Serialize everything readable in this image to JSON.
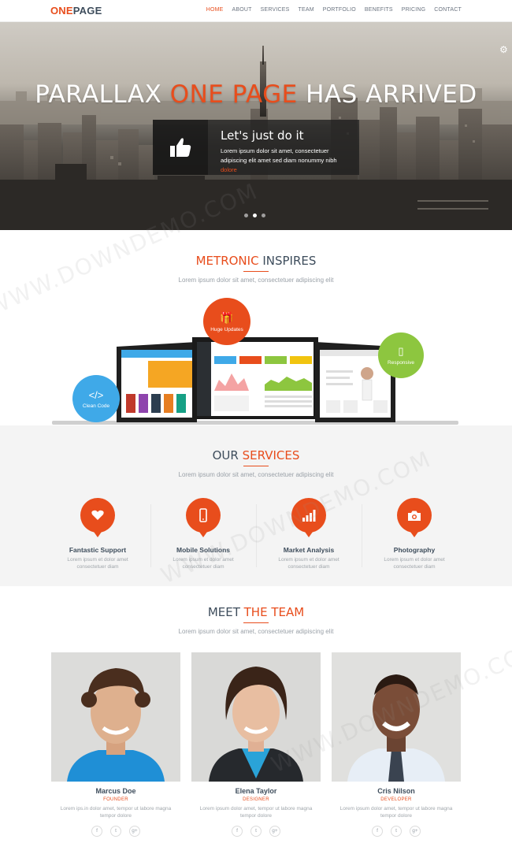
{
  "nav": {
    "logo_a": "ONE",
    "logo_b": "PAGE",
    "items": [
      "HOME",
      "ABOUT",
      "SERVICES",
      "TEAM",
      "PORTFOLIO",
      "BENEFITS",
      "PRICING",
      "CONTACT"
    ],
    "active": "HOME"
  },
  "hero": {
    "title_a": "PARALLAX ",
    "title_b": "ONE PAGE",
    "title_c": " HAS ARRIVED",
    "box_title": "Let's just do it",
    "box_text": "Lorem ipsum dolor sit amet, consectetuer adipiscing elit amet sed diam nonummy nibh ",
    "box_more": "dolore",
    "slides": 3,
    "active_slide": 2
  },
  "inspires": {
    "title_a": "METRONIC",
    "title_b": " INSPIRES",
    "subtitle": "Lorem ipsum dolor sit amet, consectetuer adipiscing elit",
    "bubbles": {
      "updates": "Huge Updates",
      "responsive": "Responsive",
      "code": "Clean Code"
    }
  },
  "services": {
    "title_a": "OUR ",
    "title_b": "SERVICES",
    "subtitle": "Lorem ipsum dolor sit amet, consectetuer adipiscing elit",
    "items": [
      {
        "title": "Fantastic Support",
        "text1": "Lorem ipsum et dolor amet",
        "text2": "consectetuer diam",
        "icon": "heart-icon"
      },
      {
        "title": "Mobile Solutions",
        "text1": "Lorem ipsum et dolor amet",
        "text2": "consectetuer diam",
        "icon": "mobile-icon"
      },
      {
        "title": "Market Analysis",
        "text1": "Lorem ipsum et dolor amet",
        "text2": "consectetuer diam",
        "icon": "bar-chart-icon"
      },
      {
        "title": "Photography",
        "text1": "Lorem ipsum et dolor amet",
        "text2": "consectetuer diam",
        "icon": "camera-icon"
      }
    ]
  },
  "team": {
    "title_a": "MEET ",
    "title_b": "THE TEAM",
    "subtitle": "Lorem ipsum dolor sit amet, consectetuer adipiscing elit",
    "members": [
      {
        "name": "Marcus Doe",
        "role": "FOUNDER",
        "text1": "Lorem ips.in dolor amet, tempor ut labore magna",
        "text2": "tempor dolore"
      },
      {
        "name": "Elena Taylor",
        "role": "DESIGNER",
        "text1": "Lorem ipsum dolor amet, tempor ut labore magna",
        "text2": "tempor dolore"
      },
      {
        "name": "Cris Nilson",
        "role": "DEVELOPER",
        "text1": "Lorem ipsum dolor amet, tempor ut labore magna",
        "text2": "tempor dolore"
      }
    ],
    "social": [
      "f",
      "t",
      "g+"
    ]
  },
  "watermark": "WWW.DOWNDEMO.COM",
  "colors": {
    "accent": "#e84d1c",
    "heading": "#3e4d5c",
    "green": "#8dc63f",
    "blue": "#3fa9e8"
  }
}
